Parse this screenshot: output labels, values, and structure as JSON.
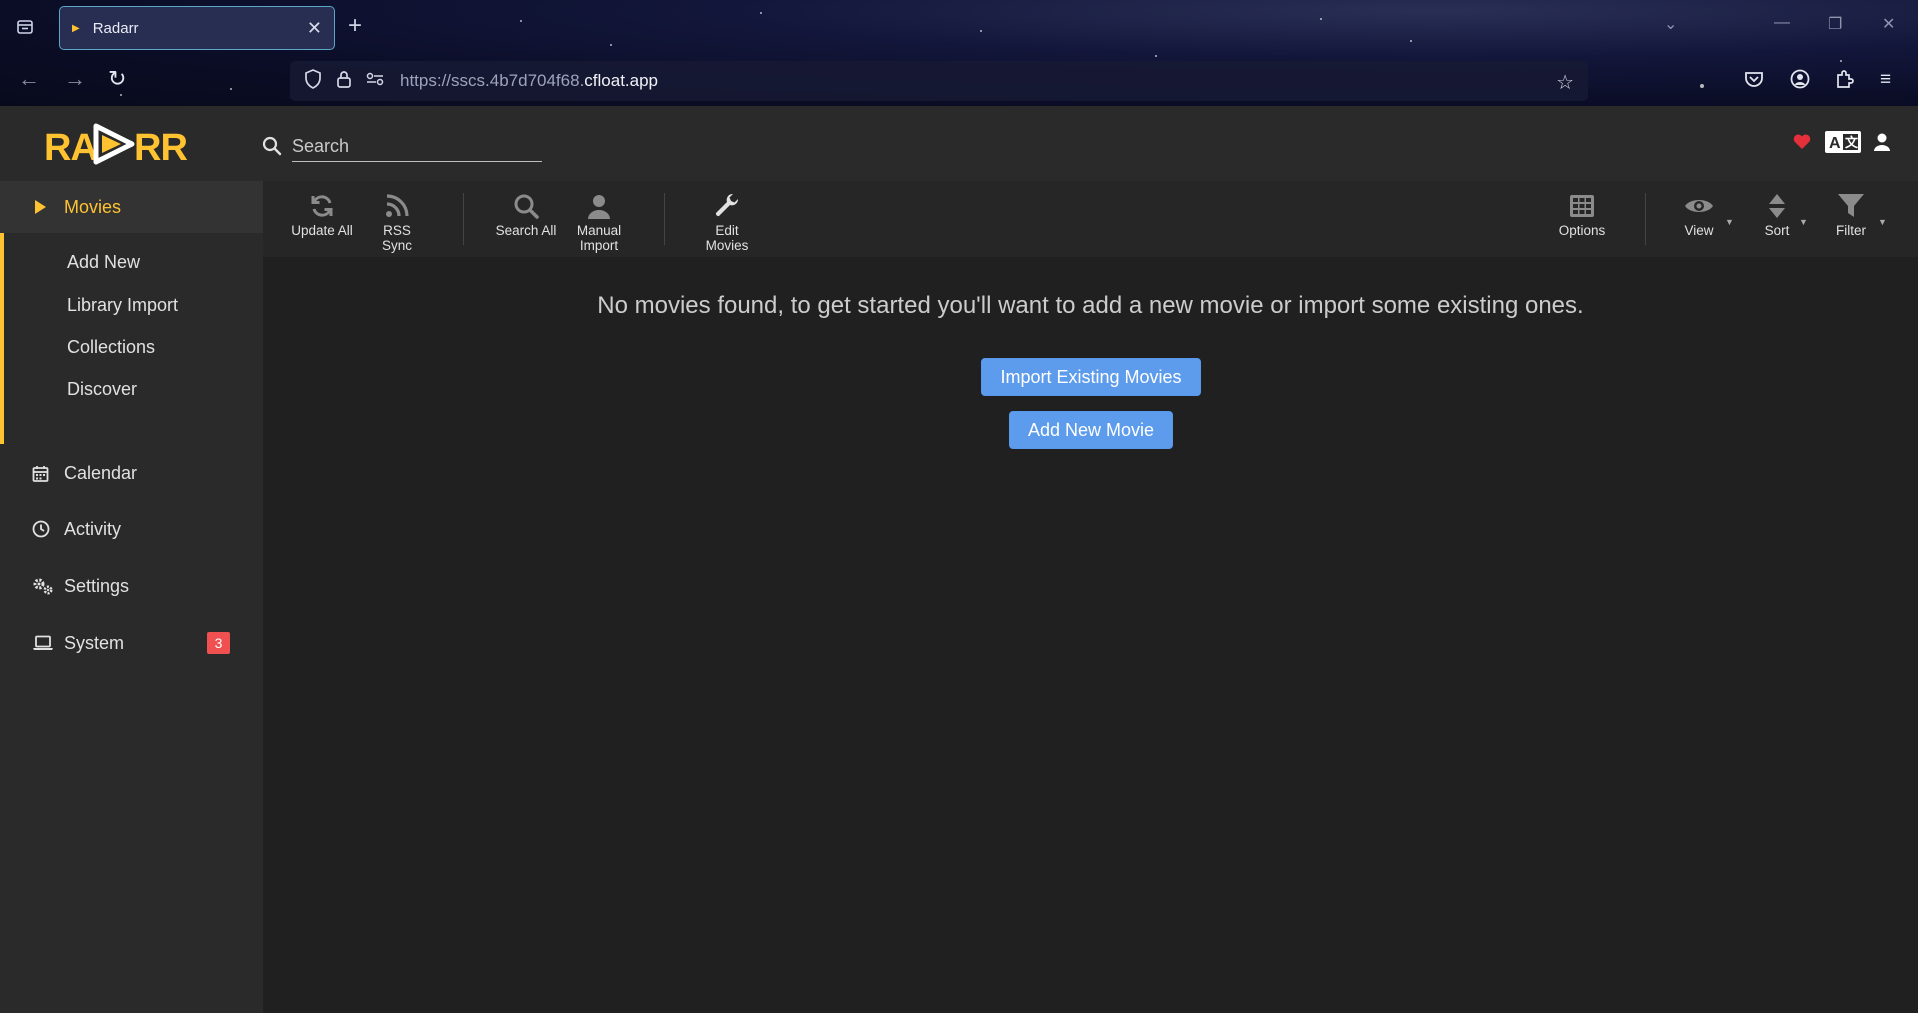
{
  "browser": {
    "tab_title": "Radarr",
    "url_dim": "https://sscs.4b7d704f68.",
    "url_bright": "cfloat.app"
  },
  "app": {
    "search_placeholder": "Search"
  },
  "sidebar": {
    "movies": "Movies",
    "sub_items": [
      "Add New",
      "Library Import",
      "Collections",
      "Discover"
    ],
    "calendar": "Calendar",
    "activity": "Activity",
    "settings": "Settings",
    "system": "System",
    "system_badge": "3"
  },
  "toolbar": {
    "update_all": "Update All",
    "rss_sync": "RSS Sync",
    "search_all": "Search All",
    "manual_import_1": "Manual",
    "manual_import_2": "Import",
    "edit_movies_1": "Edit",
    "edit_movies_2": "Movies",
    "options": "Options",
    "view": "View",
    "sort": "Sort",
    "filter": "Filter"
  },
  "main": {
    "empty_message": "No movies found, to get started you'll want to add a new movie or import some existing ones.",
    "import_button": "Import Existing Movies",
    "add_button": "Add New Movie"
  },
  "colors": {
    "accent": "#ffc230",
    "primary_button": "#5d9cec",
    "badge": "#f05050",
    "heart": "#e3303b"
  }
}
